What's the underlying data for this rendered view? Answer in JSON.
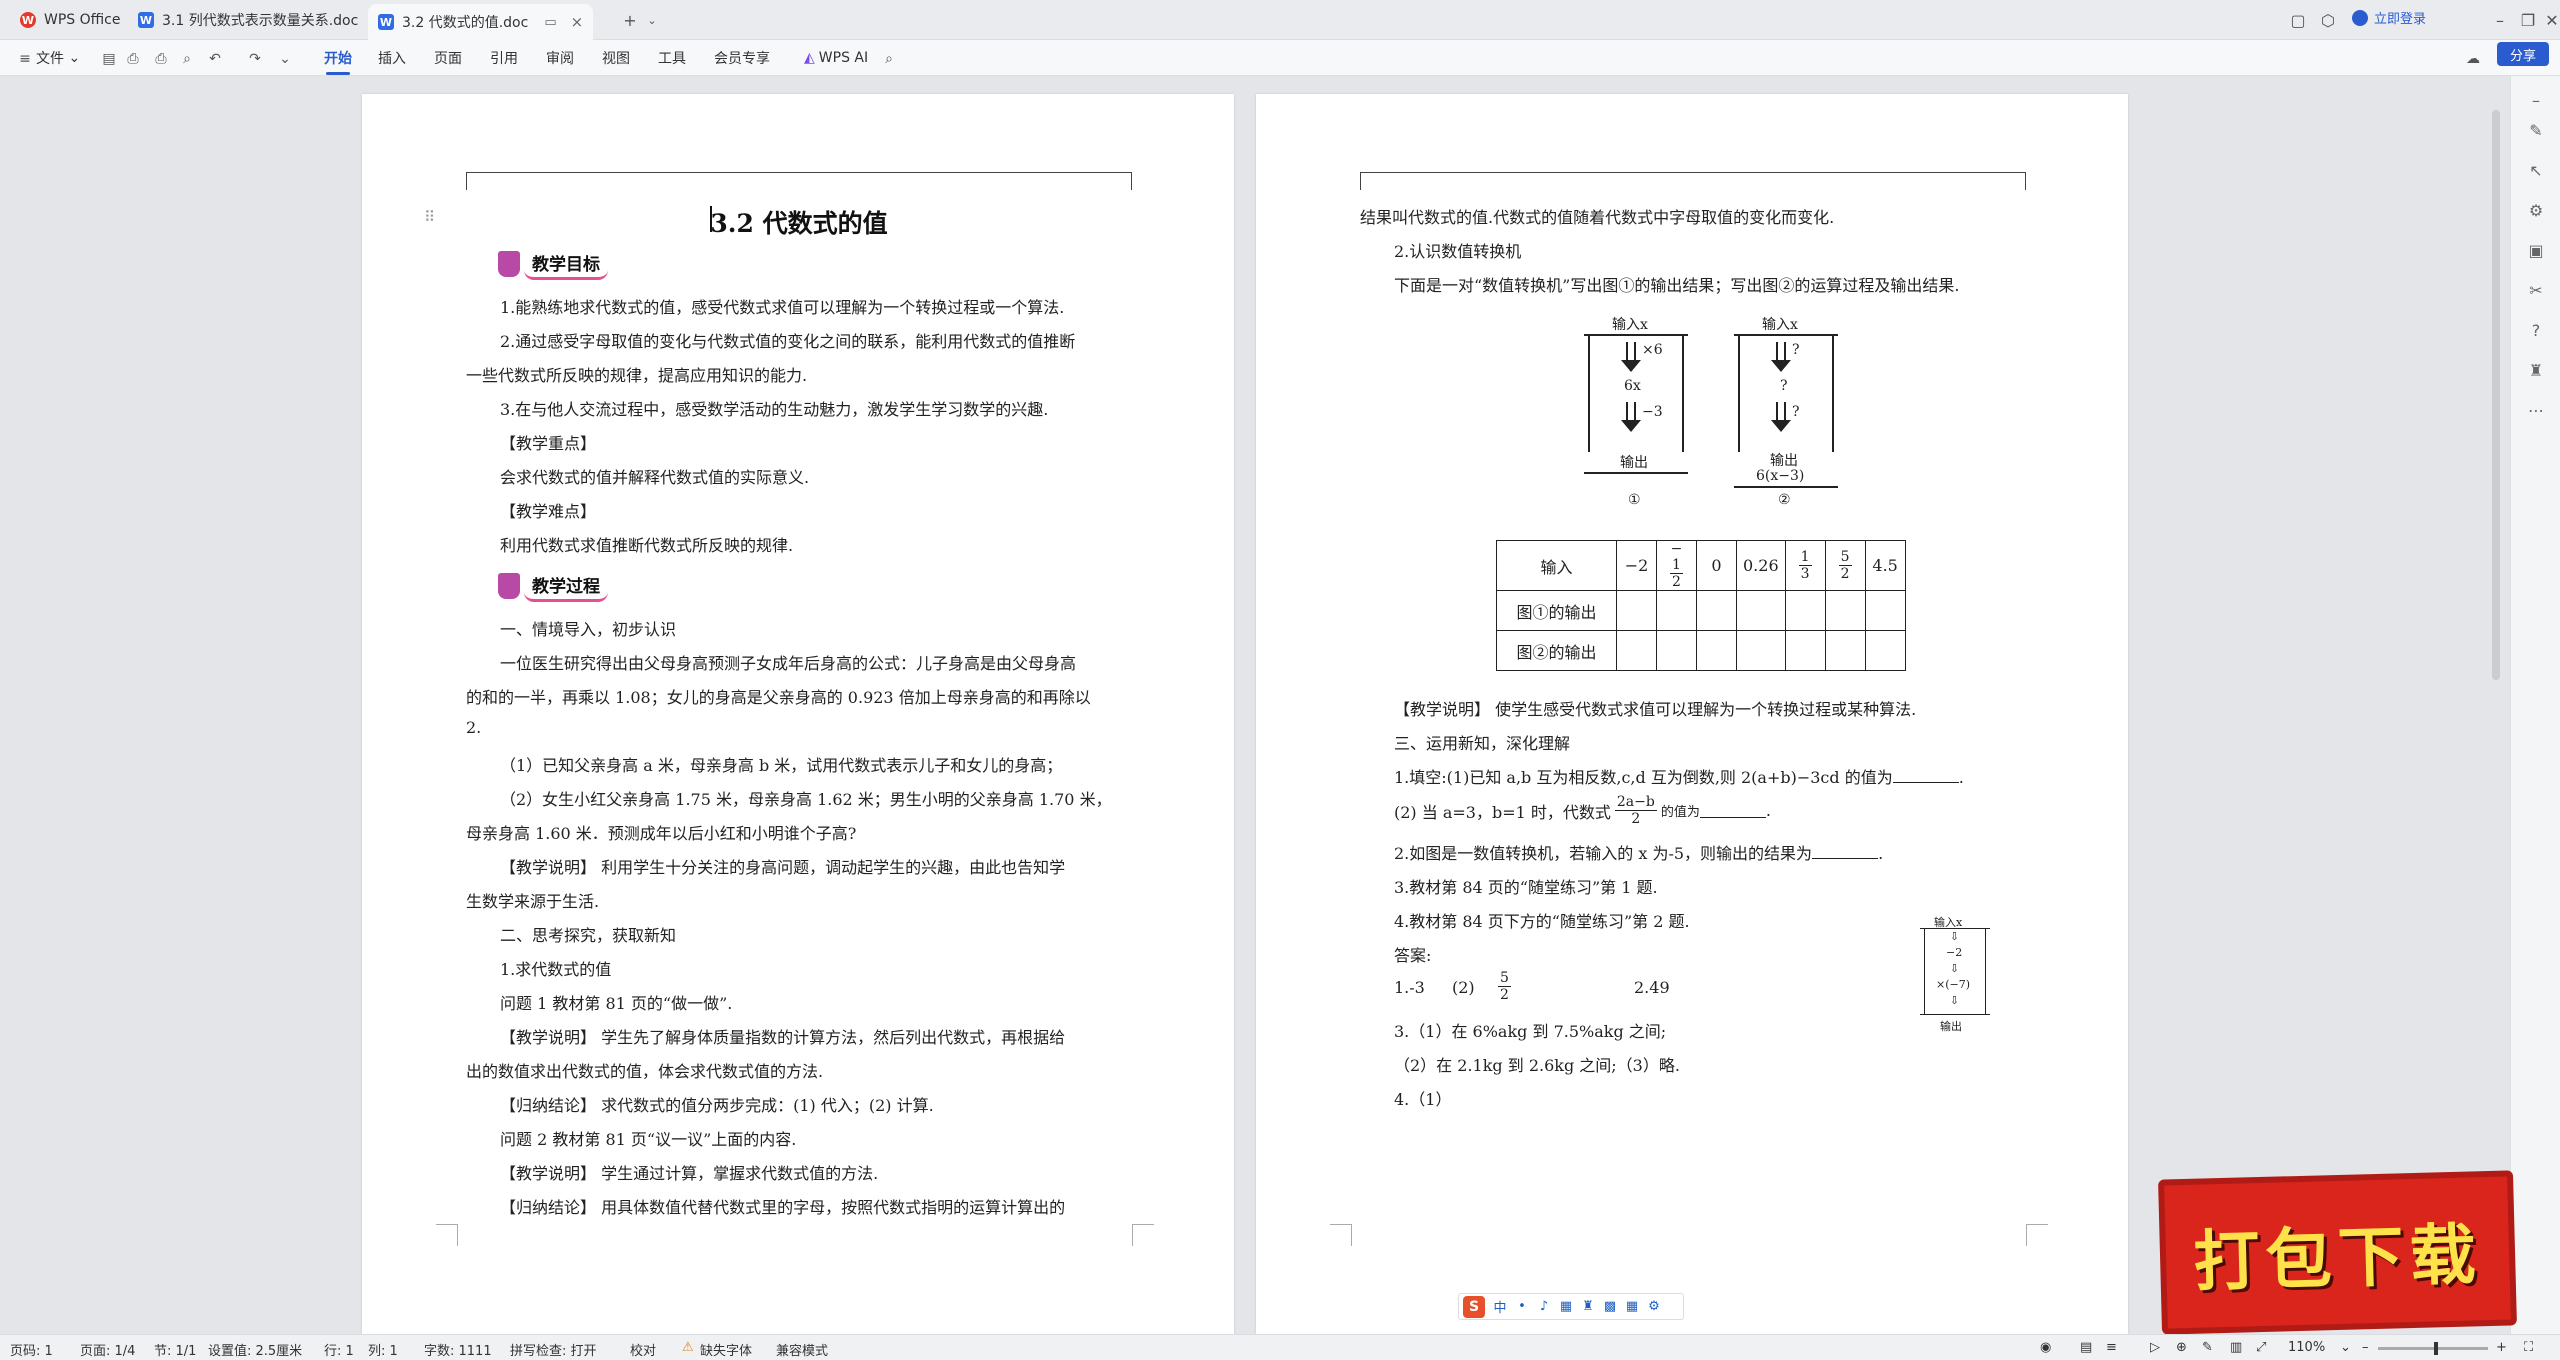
{
  "tabs": [
    {
      "label": "WPS Office",
      "type": "home"
    },
    {
      "label": "3.1 列代数式表示数量关系.doc",
      "type": "doc"
    },
    {
      "label": "3.2 代数式的值.doc",
      "type": "doc",
      "active": true
    }
  ],
  "titlebar": {
    "login_label": "立即登录"
  },
  "ribbon": {
    "file_label": "文件",
    "tabs": [
      "开始",
      "插入",
      "页面",
      "引用",
      "审阅",
      "视图",
      "工具",
      "会员专享"
    ],
    "active_tab": "开始",
    "wps_ai_label": "WPS AI",
    "share_label": "分享"
  },
  "page_left": {
    "title": "3.2 代数式的值",
    "badge_goal": "教学目标",
    "badge_process": "教学过程",
    "lines": [
      "1.能熟练地求代数式的值，感受代数式求值可以理解为一个转换过程或一个算法.",
      "2.通过感受字母取值的变化与代数式值的变化之间的联系，能利用代数式的值推断",
      "一些代数式所反映的规律，提高应用知识的能力.",
      "3.在与他人交流过程中，感受数学活动的生动魅力，激发学生学习数学的兴趣.",
      "【教学重点】",
      "会求代数式的值并解释代数式值的实际意义.",
      "【教学难点】",
      "利用代数式求值推断代数式所反映的规律.",
      "一、情境导入，初步认识",
      "一位医生研究得出由父母身高预测子女成年后身高的公式：儿子身高是由父母身高",
      "的和的一半，再乘以 1.08；女儿的身高是父亲身高的 0.923 倍加上母亲身高的和再除以",
      "2.",
      "（1）已知父亲身高 a 米，母亲身高 b 米，试用代数式表示儿子和女儿的身高；",
      "（2）女生小红父亲身高 1.75 米，母亲身高 1.62 米；男生小明的父亲身高 1.70 米，",
      "母亲身高 1.60 米．预测成年以后小红和小明谁个子高?",
      "【教学说明】 利用学生十分关注的身高问题，调动起学生的兴趣，由此也告知学",
      "生数学来源于生活.",
      "二、思考探究，获取新知",
      "1.求代数式的值",
      "问题 1 教材第 81 页的“做一做”.",
      "【教学说明】 学生先了解身体质量指数的计算方法，然后列出代数式，再根据给",
      "出的数值求出代数式的值，体会求代数式值的方法.",
      "【归纳结论】 求代数式的值分两步完成：(1) 代入；(2) 计算.",
      "问题 2 教材第 81 页“议一议”上面的内容.",
      "【教学说明】 学生通过计算，掌握求代数式值的方法.",
      "【归纳结论】 用具体数值代替代数式里的字母，按照代数式指明的运算计算出的"
    ]
  },
  "page_right": {
    "lines_top": [
      "结果叫代数式的值.代数式的值随着代数式中字母取值的变化而变化.",
      "2.认识数值转换机",
      "下面是一对“数值转换机”写出图①的输出结果；写出图②的运算过程及输出结果."
    ],
    "machine1": {
      "input": "输入x",
      "op1": "×6",
      "mid": "6x",
      "op2": "−3",
      "output": "输出",
      "label": "①"
    },
    "machine2": {
      "input": "输入x",
      "op1": "?",
      "mid": "?",
      "op2": "?",
      "output": "输出",
      "result": "6(x−3)",
      "label": "②"
    },
    "table": {
      "header": "输入",
      "inputs": [
        "−2",
        "−1/2",
        "0",
        "0.26",
        "1/3",
        "5/2",
        "4.5"
      ],
      "rows": [
        "图①的输出",
        "图②的输出"
      ]
    },
    "lines_bottom": [
      "【教学说明】 使学生感受代数式求值可以理解为一个转换过程或某种算法.",
      "三、运用新知，深化理解",
      "1.填空:(1)已知 a,b 互为相反数,c,d 互为倒数,则 2(a+b)−3cd 的值为",
      "(2) 当 a=3，b=1 时，代数式",
      "的值为",
      "2.如图是一数值转换机，若输入的 x 为-5，则输出的结果为",
      "3.教材第 84 页的“随堂练习”第 1 题.",
      "4.教材第 84 页下方的“随堂练习”第 2 题.",
      "答案:",
      "1.-3",
      "(2)",
      "2.49",
      "3.（1）在 6%akg 到 7.5%akg 之间;",
      "（2）在 2.1kg 到 2.6kg 之间;（3）略.",
      "4.（1）"
    ],
    "fraction_expr": {
      "num": "2a−b",
      "den": "2"
    },
    "fraction_ans": {
      "num": "5",
      "den": "2"
    },
    "small_machine": {
      "input": "输入x",
      "op1": "−2",
      "op2": "×(−7)",
      "output": "输出"
    }
  },
  "statusbar": {
    "page": "页码: 1",
    "pages": "页面: 1/4",
    "section": "节: 1/1",
    "setting": "设置值: 2.5厘米",
    "row": "行: 1",
    "col": "列: 1",
    "words": "字数: 1111",
    "spell": "拼写检查: 打开",
    "proof": "校对",
    "missing_font": "缺失字体",
    "compat": "兼容模式",
    "zoom": "110%"
  },
  "ime": {
    "label": "中"
  },
  "banner": {
    "text": "打包下载"
  }
}
